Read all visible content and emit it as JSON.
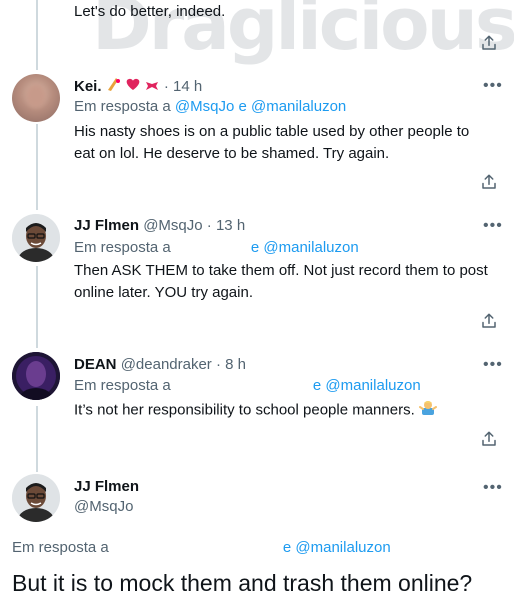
{
  "watermark": "Draglicious",
  "tweet_top": {
    "text": "Let's do better, indeed."
  },
  "tweets": [
    {
      "name": "Kei.",
      "handle": "",
      "time": "14 h",
      "reply_label": "Em resposta a",
      "mentions": [
        "@MsqJo",
        "e @manilaluzon"
      ],
      "text": "His nasty shoes is on a public table used by other people to eat on lol. He deserve to be shamed. Try again."
    },
    {
      "name": "JJ Flmen",
      "handle": "@MsqJo",
      "time": "13 h",
      "reply_label": "Em resposta a",
      "mentions": [
        "e @manilaluzon"
      ],
      "text": "Then ASK THEM to take them off. Not just record them to post online later. YOU try again."
    },
    {
      "name": "DEAN",
      "handle": "@deandraker",
      "time": "8 h",
      "reply_label": "Em resposta a",
      "mentions": [
        "e @manilaluzon"
      ],
      "text": "It’s not her responsibility to school people manners."
    }
  ],
  "main_tweet": {
    "name": "JJ Flmen",
    "handle": "@MsqJo",
    "reply_label": "Em resposta a",
    "mention": "e @manilaluzon",
    "text": "But it is to mock them and trash them online?"
  },
  "sep": "·",
  "more_glyph": "•••",
  "colors": {
    "accent": "#1d9bf0",
    "muted": "#536471",
    "line": "#cfd9de"
  }
}
